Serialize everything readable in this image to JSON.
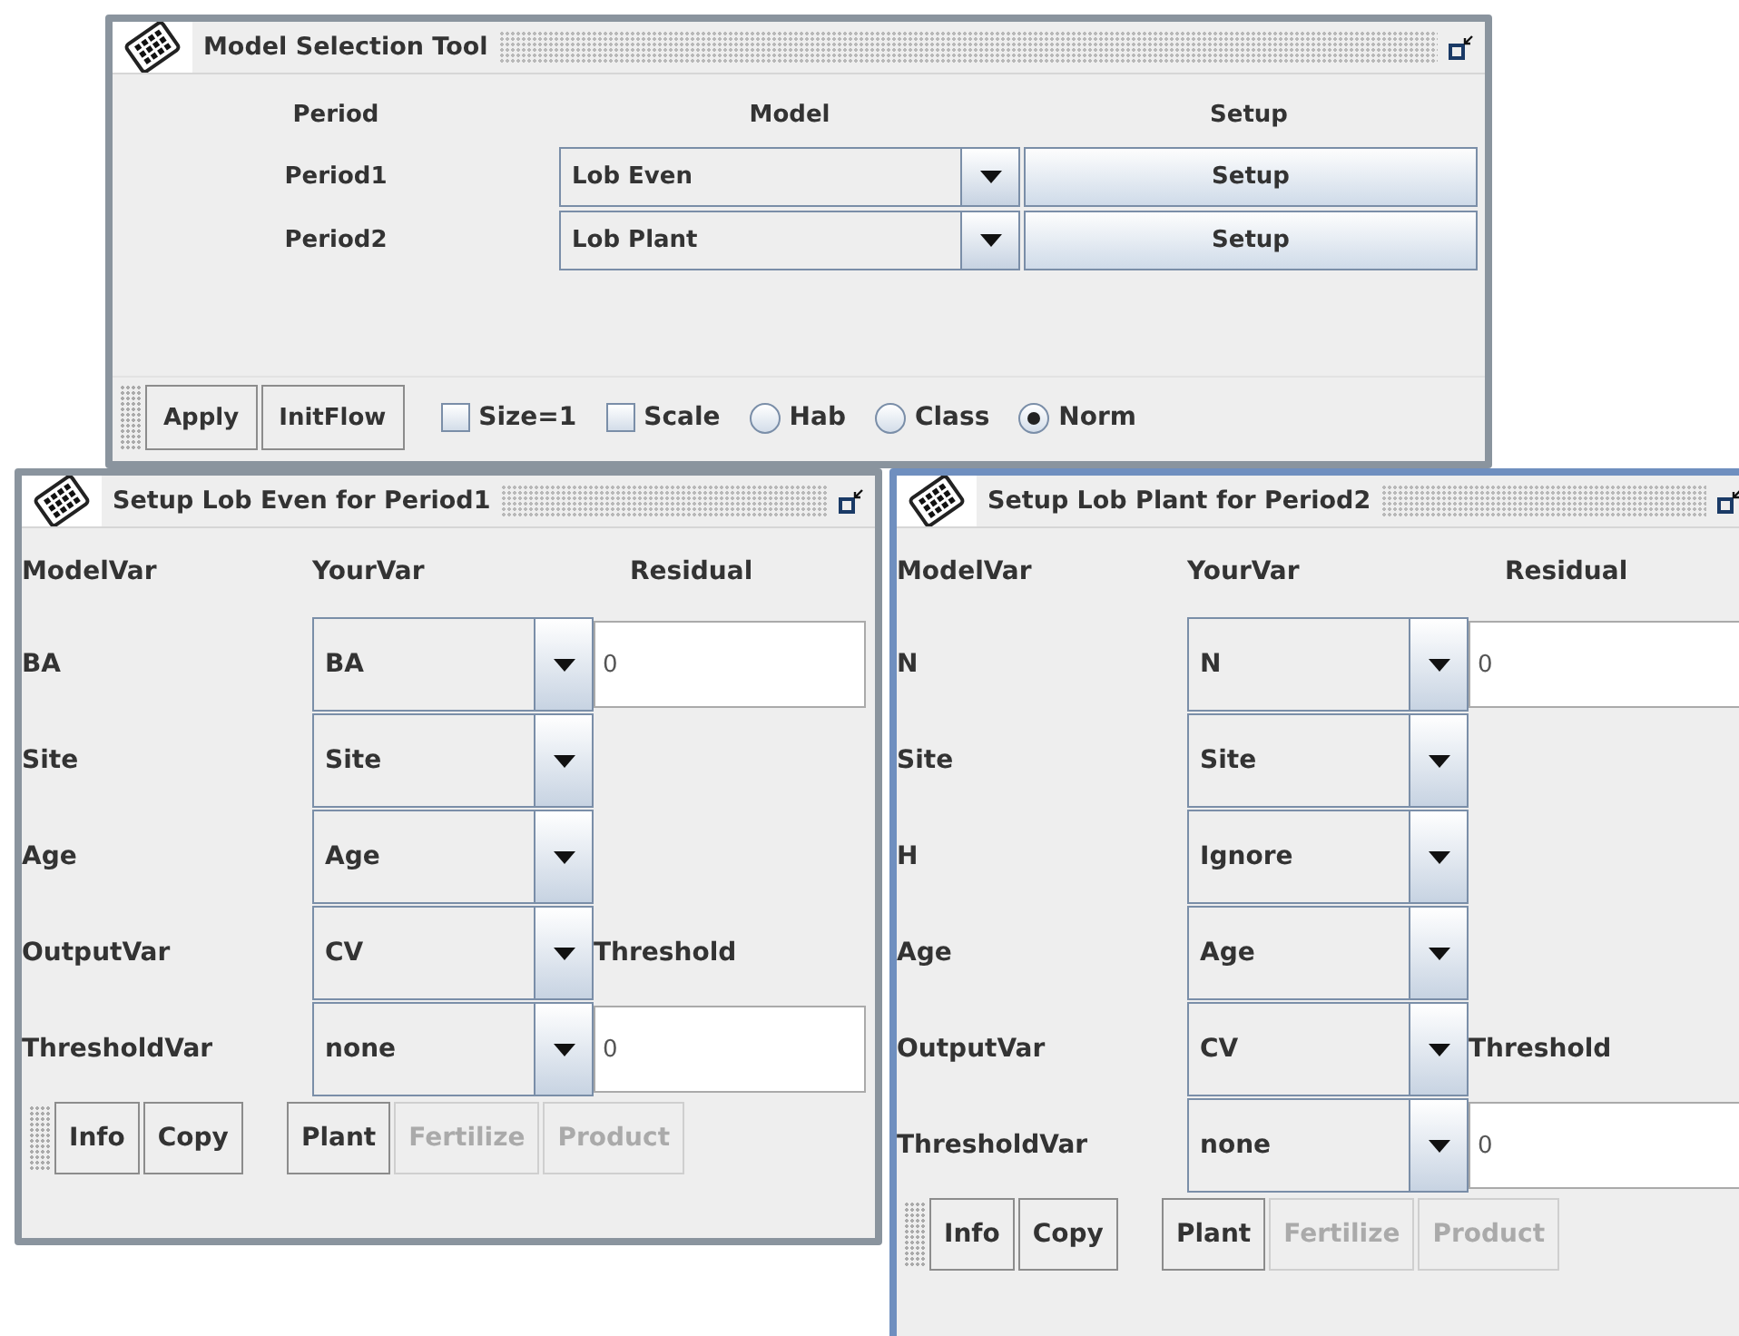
{
  "main_window": {
    "title": "Model Selection Tool",
    "active": false,
    "headers": [
      "Period",
      "Model",
      "Setup"
    ],
    "rows": [
      {
        "period": "Period1",
        "model": "Lob Even",
        "button": "Setup"
      },
      {
        "period": "Period2",
        "model": "Lob Plant",
        "button": "Setup"
      }
    ],
    "buttons": [
      "Apply",
      "InitFlow"
    ],
    "options": [
      {
        "kind": "checkbox",
        "label": "Size=1",
        "checked": false
      },
      {
        "kind": "checkbox",
        "label": "Scale",
        "checked": false
      },
      {
        "kind": "radio",
        "label": "Hab",
        "selected": false
      },
      {
        "kind": "radio",
        "label": "Class",
        "selected": false
      },
      {
        "kind": "radio",
        "label": "Norm",
        "selected": true
      }
    ]
  },
  "setup_windows": [
    {
      "title": "Setup Lob Even for Period1",
      "active": false,
      "headers": [
        "ModelVar",
        "YourVar",
        "Residual"
      ],
      "rows": [
        {
          "model_var": "BA",
          "your_var": "BA",
          "extra": {
            "kind": "field",
            "value": "0"
          }
        },
        {
          "model_var": "Site",
          "your_var": "Site"
        },
        {
          "model_var": "Age",
          "your_var": "Age"
        },
        {
          "model_var": "OutputVar",
          "your_var": "CV",
          "extra": {
            "kind": "label",
            "text": "Threshold"
          }
        },
        {
          "model_var": "ThresholdVar",
          "your_var": "none",
          "extra": {
            "kind": "field",
            "value": "0"
          }
        }
      ],
      "left_buttons": [
        {
          "label": "Info",
          "disabled": false
        },
        {
          "label": "Copy",
          "disabled": false
        }
      ],
      "right_buttons": [
        {
          "label": "Plant",
          "disabled": false
        },
        {
          "label": "Fertilize",
          "disabled": true
        },
        {
          "label": "Product",
          "disabled": true
        }
      ]
    },
    {
      "title": "Setup Lob Plant for Period2",
      "active": true,
      "headers": [
        "ModelVar",
        "YourVar",
        "Residual"
      ],
      "rows": [
        {
          "model_var": "N",
          "your_var": "N",
          "extra": {
            "kind": "field",
            "value": "0"
          }
        },
        {
          "model_var": "Site",
          "your_var": "Site"
        },
        {
          "model_var": "H",
          "your_var": "Ignore"
        },
        {
          "model_var": "Age",
          "your_var": "Age"
        },
        {
          "model_var": "OutputVar",
          "your_var": "CV",
          "extra": {
            "kind": "label",
            "text": "Threshold"
          }
        },
        {
          "model_var": "ThresholdVar",
          "your_var": "none",
          "extra": {
            "kind": "field",
            "value": "0"
          }
        }
      ],
      "left_buttons": [
        {
          "label": "Info",
          "disabled": false
        },
        {
          "label": "Copy",
          "disabled": false
        }
      ],
      "right_buttons": [
        {
          "label": "Plant",
          "disabled": false
        },
        {
          "label": "Fertilize",
          "disabled": true
        },
        {
          "label": "Product",
          "disabled": true
        }
      ]
    }
  ]
}
